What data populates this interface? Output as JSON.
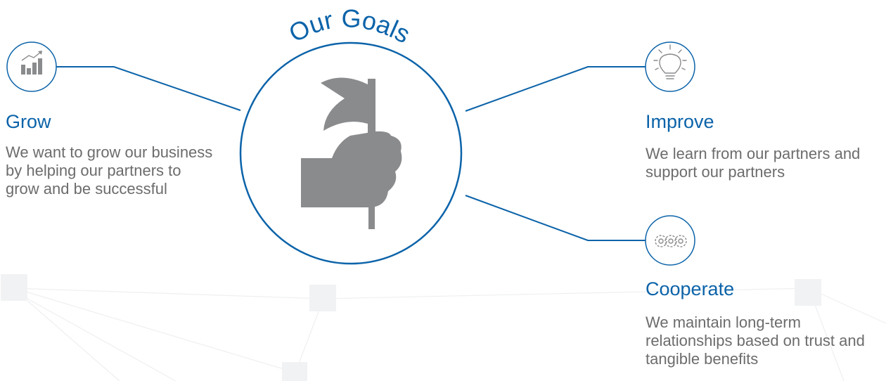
{
  "heading": "Our Goals",
  "colors": {
    "accent": "#0b63a9",
    "icon_gray": "#8a8b8d",
    "text_gray": "#6c6c6c",
    "network": "#eeeff1"
  },
  "goals": [
    {
      "icon": "bar-chart-icon",
      "title": "Grow",
      "text": "We want to grow our business by helping our partners to grow and be successful"
    },
    {
      "icon": "lightbulb-icon",
      "title": "Improve",
      "text": "We learn from our partners and support our partners"
    },
    {
      "icon": "gears-icon",
      "title": "Cooperate",
      "text": "We maintain long-term relationships based on trust and tangible benefits"
    }
  ],
  "center_icon": "hand-holding-flag-icon"
}
